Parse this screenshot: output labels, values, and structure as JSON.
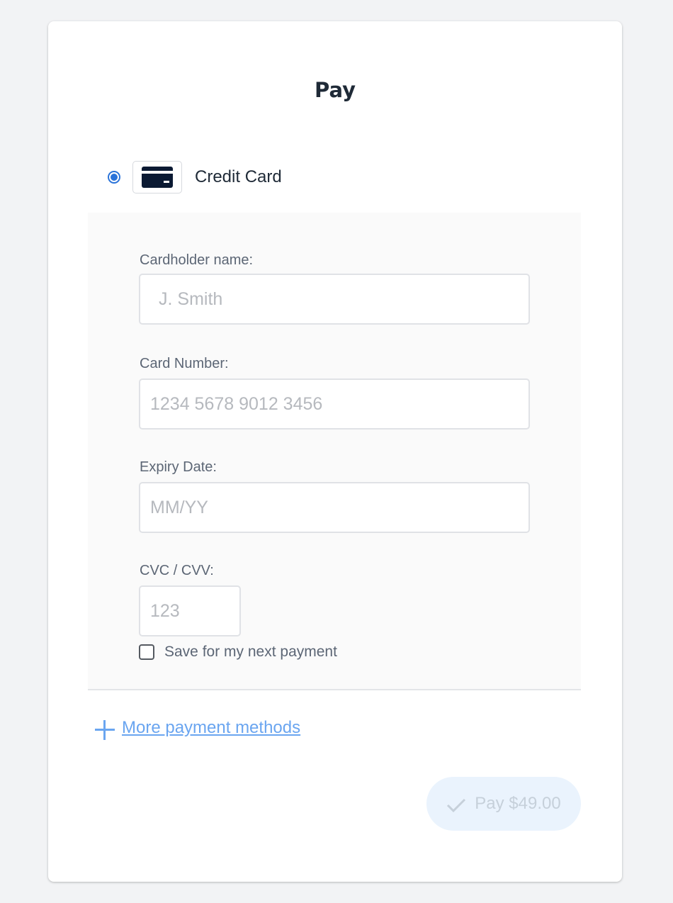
{
  "title": "Pay",
  "payment_method": {
    "label": "Credit Card",
    "selected": true,
    "icon": "credit-card-icon"
  },
  "form": {
    "cardholder": {
      "label": "Cardholder name:",
      "placeholder": "J. Smith",
      "value": ""
    },
    "card_number": {
      "label": "Card Number:",
      "placeholder": "1234 5678 9012 3456",
      "value": ""
    },
    "expiry": {
      "label": "Expiry Date:",
      "placeholder": "MM/YY",
      "value": ""
    },
    "cvc": {
      "label": "CVC / CVV:",
      "placeholder": "123",
      "value": ""
    },
    "save": {
      "label": "Save for my next payment",
      "checked": false
    }
  },
  "more_methods": {
    "label": "More payment methods",
    "icon": "plus-icon"
  },
  "pay_button": {
    "label": "Pay $49.00",
    "icon": "check-icon"
  },
  "colors": {
    "accent": "#2a73d9",
    "link": "#6aa5f0",
    "pay_button_bg": "#eaf3fd",
    "page_bg": "#f2f3f5"
  }
}
